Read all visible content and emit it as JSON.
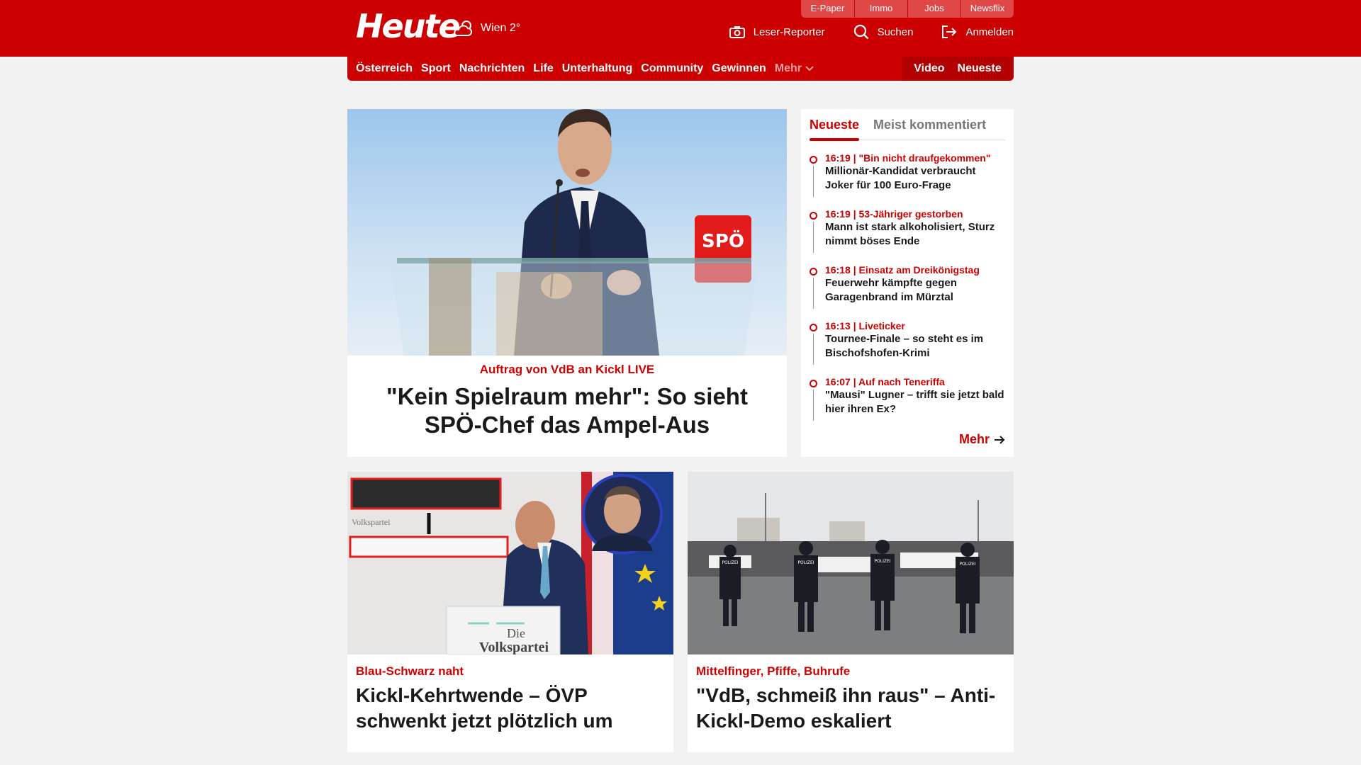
{
  "header": {
    "logo": "Heute",
    "weather": "Wien 2°",
    "service_links": [
      "E-Paper",
      "Immo",
      "Jobs",
      "Newsflix"
    ],
    "tools": {
      "reporter": "Leser-Reporter",
      "search": "Suchen",
      "login": "Anmelden"
    }
  },
  "nav": {
    "items": [
      "Österreich",
      "Sport",
      "Nachrichten",
      "Life",
      "Unterhaltung",
      "Community",
      "Gewinnen"
    ],
    "more": "Mehr",
    "video": "Video",
    "latest": "Neueste"
  },
  "lead": {
    "kicker": "Auftrag von VdB an Kickl LIVE",
    "title": "\"Kein Spielraum mehr\": So sieht SPÖ-Chef das Ampel-Aus",
    "podium_logo": "SPÖ"
  },
  "sidebar": {
    "tabs": [
      "Neueste",
      "Meist kommentiert"
    ],
    "items": [
      {
        "kicker": "16:19 | \"Bin nicht draufgekommen\"",
        "title": "Millionär-Kandidat verbraucht Joker für 100 Euro-Frage"
      },
      {
        "kicker": "16:19 | 53-Jähriger gestorben",
        "title": "Mann ist stark alkoholisiert, Sturz nimmt böses Ende"
      },
      {
        "kicker": "16:18 | Einsatz am Dreikönigstag",
        "title": "Feuerwehr kämpfte gegen Garagenbrand im Mürztal"
      },
      {
        "kicker": "16:13 | Liveticker",
        "title": "Tournee-Finale – so steht es im Bischofshofen-Krimi"
      },
      {
        "kicker": "16:07 | Auf nach Teneriffa",
        "title": "\"Mausi\" Lugner – trifft sie jetzt bald hier ihren Ex?"
      }
    ],
    "more": "Mehr"
  },
  "cards": [
    {
      "kicker": "Blau-Schwarz naht",
      "title": "Kickl-Kehrtwende – ÖVP schwenkt jetzt plötzlich um",
      "img_text_1": "Die",
      "img_text_2": "Volkspartei"
    },
    {
      "kicker": "Mittelfinger, Pfiffe, Buhrufe",
      "title": "\"VdB, schmeiß ihn raus\" – Anti-Kickl-Demo eskaliert",
      "img_text_1": "POLIZEI"
    }
  ],
  "colors": {
    "brand_red": "#cc0000",
    "nav_dark_red": "#b30000",
    "page_bg": "#f2f2f2"
  }
}
